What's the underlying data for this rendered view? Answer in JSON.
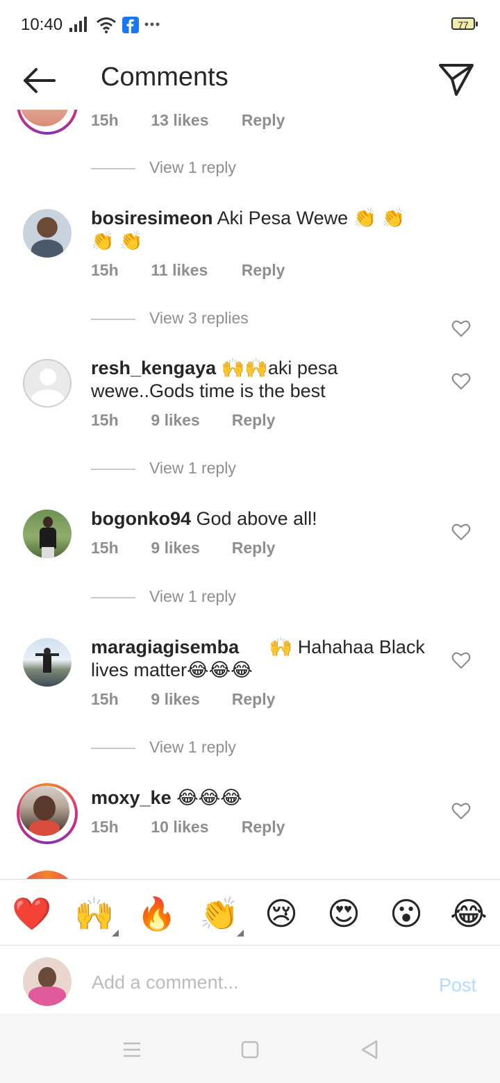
{
  "status_bar": {
    "time": "10:40",
    "battery": "77"
  },
  "header": {
    "title": "Comments"
  },
  "top_partial": {
    "time": "15h",
    "likes": "13 likes",
    "reply": "Reply"
  },
  "comments": [
    {
      "username": "bosiresimeon",
      "text": "Aki Pesa Wewe 👏 👏 👏 👏",
      "time": "15h",
      "likes": "11 likes",
      "reply": "Reply",
      "view_replies": "View 3 replies"
    },
    {
      "username": "resh_kengaya",
      "text": "🙌🙌aki pesa wewe..Gods time is the best",
      "time": "15h",
      "likes": "9 likes",
      "reply": "Reply",
      "view_replies": "View 1 reply"
    },
    {
      "username": "bogonko94",
      "text": "God above all!",
      "time": "15h",
      "likes": "9 likes",
      "reply": "Reply",
      "view_replies": "View 1 reply"
    },
    {
      "username": "maragiagisemba",
      "text": "🙌 Hahahaa Black lives matter😂😂😂",
      "time": "15h",
      "likes": "9 likes",
      "reply": "Reply",
      "view_replies": "View 1 reply"
    },
    {
      "username": "moxy_ke",
      "text": "😂😂😂",
      "time": "15h",
      "likes": "10 likes",
      "reply": "Reply"
    }
  ],
  "view_reply_top": "View 1 reply",
  "emoji_bar": [
    "❤️",
    "🙌",
    "🔥",
    "👏",
    "😢",
    "😍",
    "😮",
    "😂"
  ],
  "composer": {
    "placeholder": "Add a comment...",
    "post_label": "Post"
  },
  "colors": {
    "accent": "#0095f6",
    "post_disabled": "#b3dbff",
    "muted": "#8e8e8e"
  }
}
